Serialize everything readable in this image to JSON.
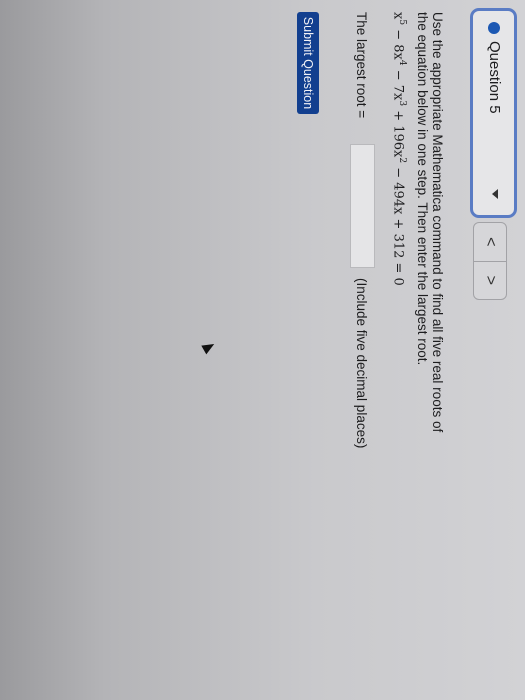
{
  "question_selector": {
    "label": "Question 5",
    "status_color": "#1c58b3",
    "dot_icon": "status-dot-icon",
    "caret_icon": "chevron-down-icon"
  },
  "nav": {
    "prev_symbol": "<",
    "next_symbol": ">"
  },
  "question": {
    "instruction": "Use the appropriate Mathematica command to find all five real roots of the equation below in one step. Then enter the largest root.",
    "equation": {
      "t1": "x",
      "t1_exp": "5",
      "t2": " − 8x",
      "t2_exp": "4",
      "t3": " − 7x",
      "t3_exp": "3",
      "t4": " + 196x",
      "t4_exp": "2",
      "t5": " − 494x + 312 = 0"
    },
    "answer_label": "The largest root =",
    "answer_value": "",
    "hint": "(Include five decimal places)"
  },
  "submit_label": "Submit Question",
  "colors": {
    "accent": "#5a7cc4",
    "submit_bg": "#123f8f"
  }
}
